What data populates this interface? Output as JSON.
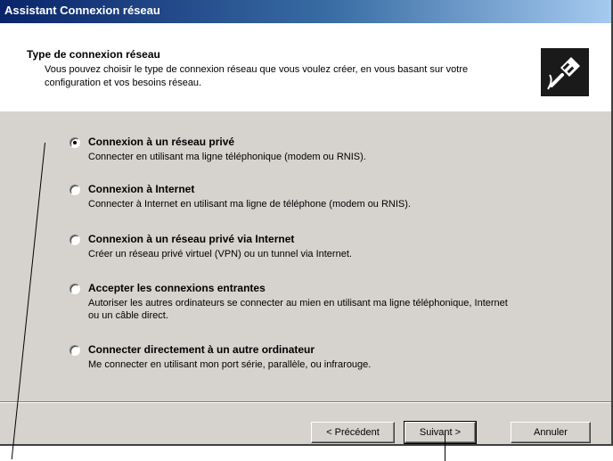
{
  "window": {
    "title": "Assistant Connexion réseau"
  },
  "header": {
    "title": "Type de connexion réseau",
    "description": "Vous pouvez choisir le type de connexion réseau que vous voulez créer, en vous basant sur votre configuration et vos besoins réseau.",
    "icon": "network-cable-icon"
  },
  "options": [
    {
      "label": "Connexion à un réseau privé",
      "description": "Connecter en utilisant ma ligne téléphonique (modem ou RNIS).",
      "selected": true
    },
    {
      "label": "Connexion à Internet",
      "description": "Connecter à Internet en utilisant ma ligne de téléphone (modem ou RNIS).",
      "selected": false
    },
    {
      "label": "Connexion à un réseau privé via Internet",
      "description": "Créer un réseau privé virtuel (VPN) ou un tunnel via Internet.",
      "selected": false
    },
    {
      "label": "Accepter les connexions entrantes",
      "description": "Autoriser les autres ordinateurs se connecter au mien en utilisant ma ligne téléphonique, Internet ou un câble direct.",
      "selected": false
    },
    {
      "label": "Connecter directement à un autre ordinateur",
      "description": "Me connecter en utilisant mon port série, parallèle, ou infrarouge.",
      "selected": false
    }
  ],
  "buttons": {
    "back": "< Précédent",
    "next": "Suivant >",
    "cancel": "Annuler"
  },
  "colors": {
    "titlebar_start": "#0a246a",
    "titlebar_end": "#a6caf0",
    "dialog_face": "#d6d3ce"
  }
}
